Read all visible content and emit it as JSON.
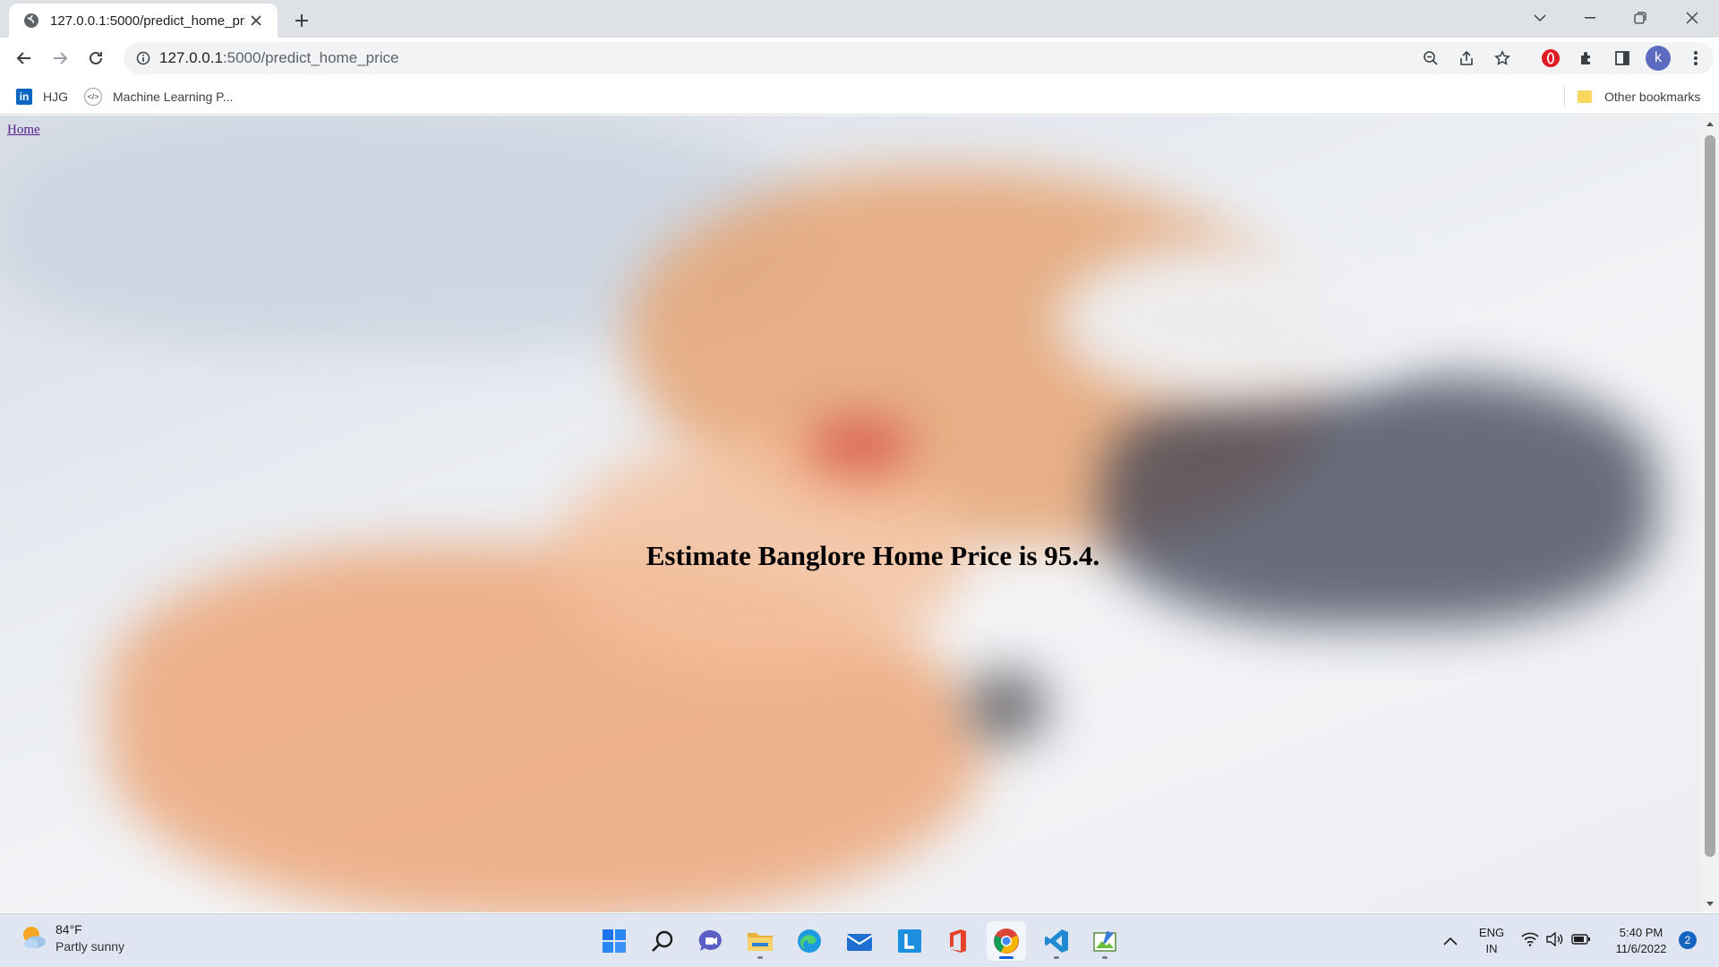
{
  "browser": {
    "tab": {
      "title": "127.0.0.1:5000/predict_home_price"
    },
    "address_bar": {
      "host": "127.0.0.1",
      "rest": ":5000/predict_home_price"
    },
    "bookmarks": {
      "items": [
        {
          "label": "HJG",
          "icon": "linkedin-icon"
        },
        {
          "label": "Machine Learning P...",
          "icon": "code-icon"
        }
      ],
      "other": "Other bookmarks"
    },
    "profile_initial": "k"
  },
  "page": {
    "home_link": "Home",
    "result_text": "Estimate Banglore Home Price is 95.4."
  },
  "taskbar": {
    "weather": {
      "temp": "84°F",
      "condition": "Partly sunny"
    },
    "language": {
      "line1": "ENG",
      "line2": "IN"
    },
    "clock": {
      "time": "5:40 PM",
      "date": "11/6/2022"
    },
    "notification_count": "2",
    "pinned_apps": [
      "start-icon",
      "search-icon",
      "chat-icon",
      "file-explorer-icon",
      "edge-icon",
      "mail-icon",
      "l-app-icon",
      "office-icon",
      "chrome-icon",
      "vscode-icon",
      "image-app-icon"
    ]
  },
  "colors": {
    "accent": "#0a5bd6",
    "link_visited": "#551a8b",
    "profile": "#5b6bc0"
  }
}
